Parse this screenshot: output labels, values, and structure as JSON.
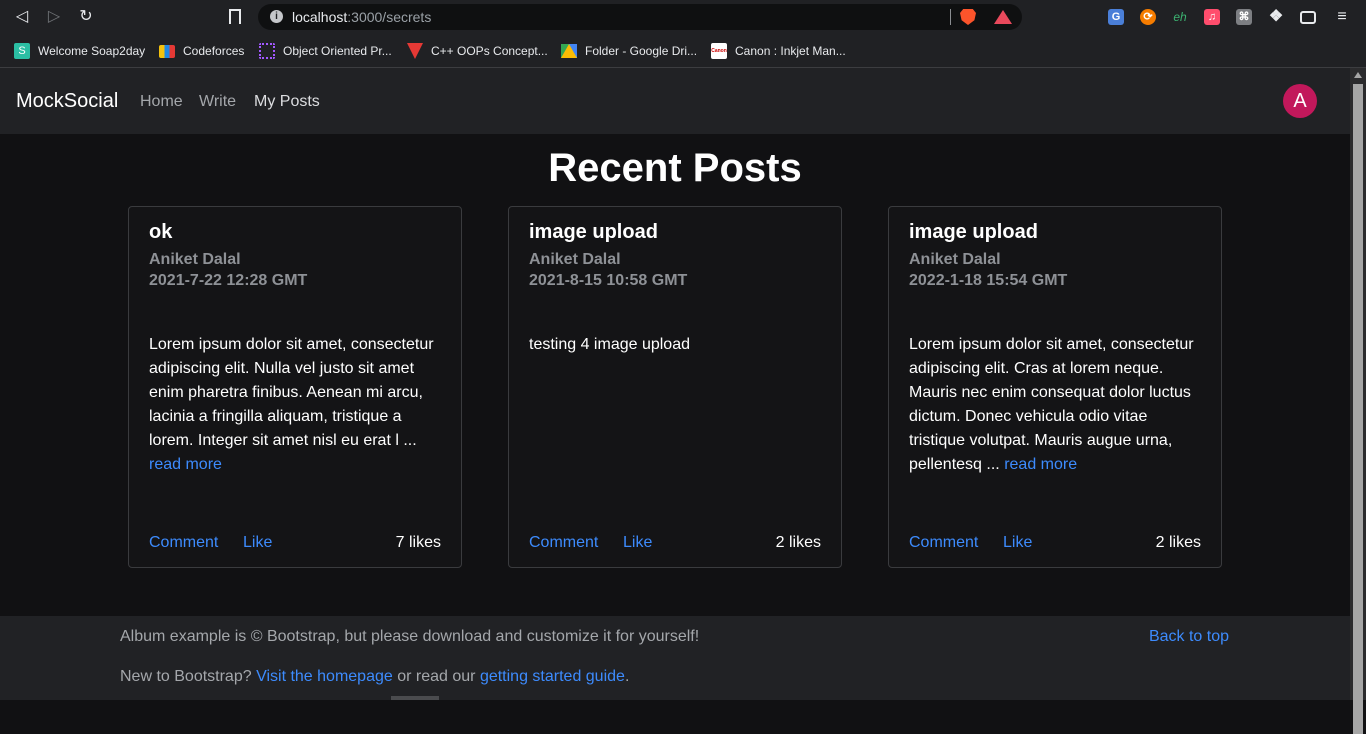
{
  "browser": {
    "url_host": "localhost",
    "url_path": ":3000/secrets",
    "info_icon": "info-icon",
    "bookmarks": [
      {
        "label": "Welcome Soap2day",
        "color": "#2bbfa4",
        "icon": "S"
      },
      {
        "label": "Codeforces",
        "color": "#f4c20d",
        "icon": "bar-chart"
      },
      {
        "label": "Object Oriented Pr...",
        "color": "#a259ff",
        "icon": "grid"
      },
      {
        "label": "C++ OOPs Concept...",
        "color": "#e53935",
        "icon": "triangle"
      },
      {
        "label": "Folder - Google Dri...",
        "color": "#34a853",
        "icon": "drive"
      },
      {
        "label": "Canon : Inkjet Man...",
        "color": "#cc0000",
        "icon": "canon"
      }
    ],
    "extensions": [
      {
        "name": "translate-icon",
        "color": "#4a7fd8",
        "glyph": "G"
      },
      {
        "name": "toggl-icon",
        "color": "#f57c00",
        "glyph": "⟳"
      },
      {
        "name": "eh-icon",
        "color": "#202124",
        "glyph": "eh"
      },
      {
        "name": "music-icon",
        "color": "#ff4d6d",
        "glyph": "♫"
      },
      {
        "name": "extension-box-icon",
        "color": "#7d7f83",
        "glyph": "⌘"
      }
    ]
  },
  "app": {
    "brand": "MockSocial",
    "nav": [
      {
        "label": "Home"
      },
      {
        "label": "Write"
      },
      {
        "label": "My Posts"
      }
    ],
    "avatar_letter": "A"
  },
  "page": {
    "heading": "Recent Posts"
  },
  "posts": [
    {
      "title": "ok",
      "author": "Aniket Dalal",
      "date": "2021-7-22 12:28 GMT",
      "lines": [
        "Lorem ipsum dolor sit amet, consectetur",
        "adipiscing elit. Nulla vel justo sit amet",
        "enim pharetra finibus. Aenean mi arcu,",
        "lacinia a fringilla aliquam, tristique a",
        "lorem. Integer sit amet nisl eu erat l ..."
      ],
      "read_more": "read more",
      "comment": "Comment",
      "like": "Like",
      "likes": "7 likes"
    },
    {
      "title": "image upload",
      "author": "Aniket Dalal",
      "date": "2021-8-15 10:58 GMT",
      "lines": [
        "testing 4 image upload"
      ],
      "read_more": "",
      "comment": "Comment",
      "like": "Like",
      "likes": "2 likes"
    },
    {
      "title": "image upload",
      "author": "Aniket Dalal",
      "date": "2022-1-18 15:54 GMT",
      "lines": [
        "Lorem ipsum dolor sit amet, consectetur",
        "adipiscing elit. Cras at lorem neque.",
        "Mauris nec enim consequat dolor luctus",
        "dictum. Donec vehicula odio vitae",
        "tristique volutpat. Mauris augue urna,"
      ],
      "last_line": "pellentesq ...",
      "read_more": "read more",
      "comment": "Comment",
      "like": "Like",
      "likes": "2 likes"
    }
  ],
  "footer": {
    "text": "Album example is © Bootstrap, but please download and customize it for yourself!",
    "back_to_top": "Back to top",
    "line2_a": "New to Bootstrap?",
    "line2_link1": "Visit the homepage",
    "line2_b": "or read our",
    "line2_link2": "getting started guide",
    "line2_c": "."
  }
}
